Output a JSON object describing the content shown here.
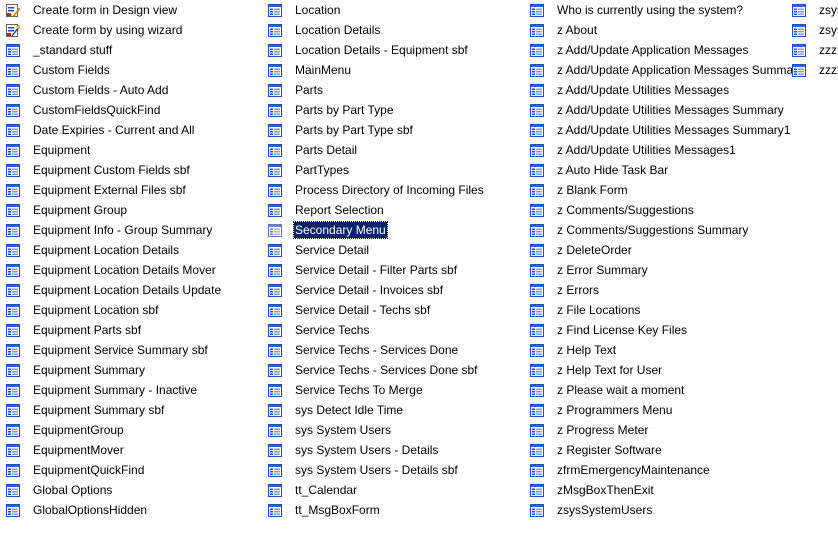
{
  "colors": {
    "selection_bg": "#0a246a",
    "selection_text": "#ffffff",
    "icon_blue": "#1f5bd6",
    "icon_red": "#c8201c"
  },
  "columns": [
    [
      {
        "label": "Create form in Design view",
        "icon": "design-view-icon"
      },
      {
        "label": "Create form by using wizard",
        "icon": "wizard-icon"
      },
      {
        "label": "_standard stuff",
        "icon": "form-icon"
      },
      {
        "label": "Custom Fields",
        "icon": "form-icon"
      },
      {
        "label": "Custom Fields - Auto Add",
        "icon": "form-icon"
      },
      {
        "label": "CustomFieldsQuickFind",
        "icon": "form-icon"
      },
      {
        "label": "Date Expiries - Current and All",
        "icon": "form-icon"
      },
      {
        "label": "Equipment",
        "icon": "form-icon"
      },
      {
        "label": "Equipment Custom Fields sbf",
        "icon": "form-icon"
      },
      {
        "label": "Equipment External Files sbf",
        "icon": "form-icon"
      },
      {
        "label": "Equipment Group",
        "icon": "form-icon"
      },
      {
        "label": "Equipment Info - Group Summary",
        "icon": "form-icon"
      },
      {
        "label": "Equipment Location Details",
        "icon": "form-icon"
      },
      {
        "label": "Equipment Location Details Mover",
        "icon": "form-icon"
      },
      {
        "label": "Equipment Location Details Update",
        "icon": "form-icon"
      },
      {
        "label": "Equipment Location sbf",
        "icon": "form-icon"
      },
      {
        "label": "Equipment Parts sbf",
        "icon": "form-icon"
      },
      {
        "label": "Equipment Service Summary sbf",
        "icon": "form-icon"
      },
      {
        "label": "Equipment Summary",
        "icon": "form-icon"
      },
      {
        "label": "Equipment Summary - Inactive",
        "icon": "form-icon"
      },
      {
        "label": "Equipment Summary sbf",
        "icon": "form-icon"
      },
      {
        "label": "EquipmentGroup",
        "icon": "form-icon"
      },
      {
        "label": "EquipmentMover",
        "icon": "form-icon"
      },
      {
        "label": "EquipmentQuickFind",
        "icon": "form-icon"
      },
      {
        "label": "Global Options",
        "icon": "form-icon"
      },
      {
        "label": "GlobalOptionsHidden",
        "icon": "form-icon"
      }
    ],
    [
      {
        "label": "Location",
        "icon": "form-icon"
      },
      {
        "label": "Location Details",
        "icon": "form-icon"
      },
      {
        "label": "Location Details - Equipment sbf",
        "icon": "form-icon"
      },
      {
        "label": "MainMenu",
        "icon": "form-icon"
      },
      {
        "label": "Parts",
        "icon": "form-icon"
      },
      {
        "label": "Parts by Part Type",
        "icon": "form-icon"
      },
      {
        "label": "Parts by Part Type sbf",
        "icon": "form-icon"
      },
      {
        "label": "Parts Detail",
        "icon": "form-icon"
      },
      {
        "label": "PartTypes",
        "icon": "form-icon"
      },
      {
        "label": "Process Directory of Incoming Files",
        "icon": "form-icon"
      },
      {
        "label": "Report Selection",
        "icon": "form-icon"
      },
      {
        "label": "Secondary Menu",
        "icon": "form-icon",
        "selected": true
      },
      {
        "label": "Service Detail",
        "icon": "form-icon"
      },
      {
        "label": "Service Detail - Filter Parts sbf",
        "icon": "form-icon"
      },
      {
        "label": "Service Detail - Invoices sbf",
        "icon": "form-icon"
      },
      {
        "label": "Service Detail - Techs sbf",
        "icon": "form-icon"
      },
      {
        "label": "Service Techs",
        "icon": "form-icon"
      },
      {
        "label": "Service Techs - Services Done",
        "icon": "form-icon"
      },
      {
        "label": "Service Techs - Services Done sbf",
        "icon": "form-icon"
      },
      {
        "label": "Service Techs To Merge",
        "icon": "form-icon"
      },
      {
        "label": "sys Detect Idle Time",
        "icon": "form-icon"
      },
      {
        "label": "sys System Users",
        "icon": "form-icon"
      },
      {
        "label": "sys System Users - Details",
        "icon": "form-icon"
      },
      {
        "label": "sys System Users - Details sbf",
        "icon": "form-icon"
      },
      {
        "label": "tt_Calendar",
        "icon": "form-icon"
      },
      {
        "label": "tt_MsgBoxForm",
        "icon": "form-icon"
      }
    ],
    [
      {
        "label": "Who is currently using the system?",
        "icon": "form-icon"
      },
      {
        "label": "z About",
        "icon": "form-icon"
      },
      {
        "label": "z Add/Update Application Messages",
        "icon": "form-icon"
      },
      {
        "label": "z Add/Update Application Messages Summary",
        "icon": "form-icon"
      },
      {
        "label": "z Add/Update Utilities Messages",
        "icon": "form-icon"
      },
      {
        "label": "z Add/Update Utilities Messages Summary",
        "icon": "form-icon"
      },
      {
        "label": "z Add/Update Utilities Messages Summary1",
        "icon": "form-icon"
      },
      {
        "label": "z Add/Update Utilities Messages1",
        "icon": "form-icon"
      },
      {
        "label": "z Auto Hide Task Bar",
        "icon": "form-icon"
      },
      {
        "label": "z Blank Form",
        "icon": "form-icon"
      },
      {
        "label": "z Comments/Suggestions",
        "icon": "form-icon"
      },
      {
        "label": "z Comments/Suggestions Summary",
        "icon": "form-icon"
      },
      {
        "label": "z DeleteOrder",
        "icon": "form-icon"
      },
      {
        "label": "z Error Summary",
        "icon": "form-icon"
      },
      {
        "label": "z Errors",
        "icon": "form-icon"
      },
      {
        "label": "z File Locations",
        "icon": "form-icon"
      },
      {
        "label": "z Find License Key Files",
        "icon": "form-icon"
      },
      {
        "label": "z Help Text",
        "icon": "form-icon"
      },
      {
        "label": "z Help Text for User",
        "icon": "form-icon"
      },
      {
        "label": "z Please wait a moment",
        "icon": "form-icon"
      },
      {
        "label": "z Programmers Menu",
        "icon": "form-icon"
      },
      {
        "label": "z Progress Meter",
        "icon": "form-icon"
      },
      {
        "label": "z Register Software",
        "icon": "form-icon"
      },
      {
        "label": "zfrmEmergencyMaintenance",
        "icon": "form-icon"
      },
      {
        "label": "zMsgBoxThenExit",
        "icon": "form-icon"
      },
      {
        "label": "zsysSystemUsers",
        "icon": "form-icon"
      }
    ],
    [
      {
        "label": "zsys",
        "icon": "form-icon"
      },
      {
        "label": "zsys",
        "icon": "form-icon"
      },
      {
        "label": "zzz",
        "icon": "form-icon"
      },
      {
        "label": "zzzz",
        "icon": "form-icon"
      }
    ]
  ]
}
